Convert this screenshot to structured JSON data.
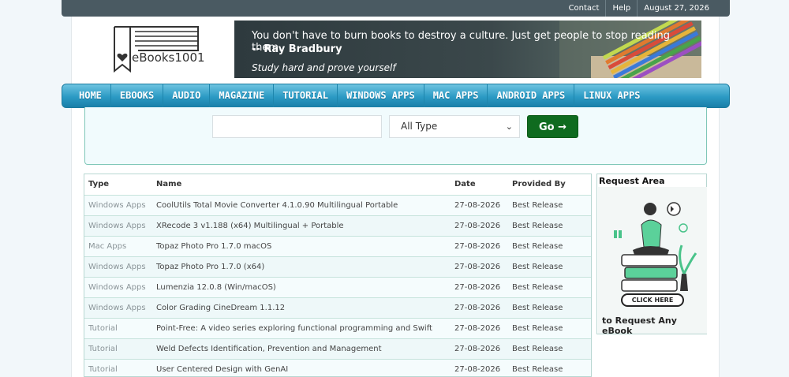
{
  "topbar": {
    "links": [
      "Contact",
      "Help"
    ],
    "date": "August 27, 2026"
  },
  "logo": {
    "text": "eBooks1001"
  },
  "banner": {
    "quote": "You don't have to burn books to destroy a culture. Just get people to stop reading them.",
    "author": "-- Ray Bradbury",
    "tagline": "Study hard and prove yourself"
  },
  "nav": [
    "HOME",
    "EBOOKS",
    "AUDIO",
    "MAGAZINE",
    "TUTORIAL",
    "WINDOWS APPS",
    "MAC APPS",
    "ANDROID APPS",
    "LINUX APPS"
  ],
  "search": {
    "value": "",
    "type_selected": "All Type",
    "go_label": "Go →"
  },
  "table": {
    "headers": {
      "type": "Type",
      "name": "Name",
      "date": "Date",
      "provider": "Provided By"
    },
    "rows": [
      {
        "type": "Windows Apps",
        "name": "CoolUtils Total Movie Converter 4.1.0.90 Multilingual Portable",
        "date": "27-08-2026",
        "provider": "Best Release"
      },
      {
        "type": "Windows Apps",
        "name": "XRecode 3 v1.188 (x64) Multilingual + Portable",
        "date": "27-08-2026",
        "provider": "Best Release"
      },
      {
        "type": "Mac Apps",
        "name": "Topaz Photo Pro 1.7.0 macOS",
        "date": "27-08-2026",
        "provider": "Best Release"
      },
      {
        "type": "Windows Apps",
        "name": "Topaz Photo Pro 1.7.0 (x64)",
        "date": "27-08-2026",
        "provider": "Best Release"
      },
      {
        "type": "Windows Apps",
        "name": "Lumenzia 12.0.8 (Win/macOS)",
        "date": "27-08-2026",
        "provider": "Best Release"
      },
      {
        "type": "Windows Apps",
        "name": "Color Grading CineDream 1.1.12",
        "date": "27-08-2026",
        "provider": "Best Release"
      },
      {
        "type": "Tutorial",
        "name": "Point-Free: A video series exploring functional programming and Swift",
        "date": "27-08-2026",
        "provider": "Best Release"
      },
      {
        "type": "Tutorial",
        "name": "Weld Defects Identification, Prevention and Management",
        "date": "27-08-2026",
        "provider": "Best Release"
      },
      {
        "type": "Tutorial",
        "name": "User Centered Design with GenAI",
        "date": "27-08-2026",
        "provider": "Best Release"
      }
    ]
  },
  "request": {
    "title": "Request Area",
    "button": "CLICK HERE",
    "cta": "to Request Any eBook"
  }
}
